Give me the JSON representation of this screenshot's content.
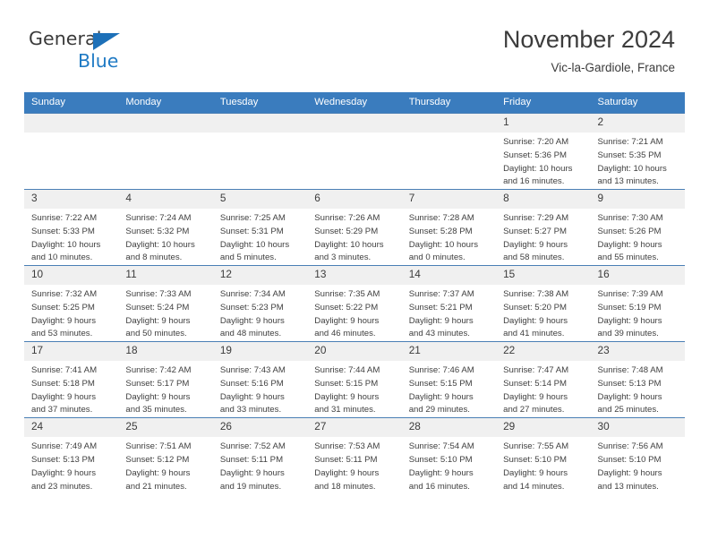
{
  "logo": {
    "word_one": "General",
    "word_two": "Blue",
    "triangle_icon": "triangle-icon",
    "brand_blue": "#1f7ac4"
  },
  "header": {
    "title": "November 2024",
    "subtitle": "Vic-la-Gardiole, France"
  },
  "calendar": {
    "header_bg": "#3a7cbe",
    "daynum_bg": "#f0f0f0",
    "weekday_names": [
      "Sunday",
      "Monday",
      "Tuesday",
      "Wednesday",
      "Thursday",
      "Friday",
      "Saturday"
    ],
    "labels": {
      "sunrise": "Sunrise:",
      "sunset": "Sunset:",
      "daylight": "Daylight:"
    },
    "weeks": [
      [
        {
          "day": "",
          "empty": true,
          "sunrise": "",
          "sunset": "",
          "daylight_line1": "",
          "daylight_line2": ""
        },
        {
          "day": "",
          "empty": true,
          "sunrise": "",
          "sunset": "",
          "daylight_line1": "",
          "daylight_line2": ""
        },
        {
          "day": "",
          "empty": true,
          "sunrise": "",
          "sunset": "",
          "daylight_line1": "",
          "daylight_line2": ""
        },
        {
          "day": "",
          "empty": true,
          "sunrise": "",
          "sunset": "",
          "daylight_line1": "",
          "daylight_line2": ""
        },
        {
          "day": "",
          "empty": true,
          "sunrise": "",
          "sunset": "",
          "daylight_line1": "",
          "daylight_line2": ""
        },
        {
          "day": "1",
          "empty": false,
          "sunrise": "Sunrise: 7:20 AM",
          "sunset": "Sunset: 5:36 PM",
          "daylight_line1": "Daylight: 10 hours",
          "daylight_line2": "and 16 minutes."
        },
        {
          "day": "2",
          "empty": false,
          "sunrise": "Sunrise: 7:21 AM",
          "sunset": "Sunset: 5:35 PM",
          "daylight_line1": "Daylight: 10 hours",
          "daylight_line2": "and 13 minutes."
        }
      ],
      [
        {
          "day": "3",
          "empty": false,
          "sunrise": "Sunrise: 7:22 AM",
          "sunset": "Sunset: 5:33 PM",
          "daylight_line1": "Daylight: 10 hours",
          "daylight_line2": "and 10 minutes."
        },
        {
          "day": "4",
          "empty": false,
          "sunrise": "Sunrise: 7:24 AM",
          "sunset": "Sunset: 5:32 PM",
          "daylight_line1": "Daylight: 10 hours",
          "daylight_line2": "and 8 minutes."
        },
        {
          "day": "5",
          "empty": false,
          "sunrise": "Sunrise: 7:25 AM",
          "sunset": "Sunset: 5:31 PM",
          "daylight_line1": "Daylight: 10 hours",
          "daylight_line2": "and 5 minutes."
        },
        {
          "day": "6",
          "empty": false,
          "sunrise": "Sunrise: 7:26 AM",
          "sunset": "Sunset: 5:29 PM",
          "daylight_line1": "Daylight: 10 hours",
          "daylight_line2": "and 3 minutes."
        },
        {
          "day": "7",
          "empty": false,
          "sunrise": "Sunrise: 7:28 AM",
          "sunset": "Sunset: 5:28 PM",
          "daylight_line1": "Daylight: 10 hours",
          "daylight_line2": "and 0 minutes."
        },
        {
          "day": "8",
          "empty": false,
          "sunrise": "Sunrise: 7:29 AM",
          "sunset": "Sunset: 5:27 PM",
          "daylight_line1": "Daylight: 9 hours",
          "daylight_line2": "and 58 minutes."
        },
        {
          "day": "9",
          "empty": false,
          "sunrise": "Sunrise: 7:30 AM",
          "sunset": "Sunset: 5:26 PM",
          "daylight_line1": "Daylight: 9 hours",
          "daylight_line2": "and 55 minutes."
        }
      ],
      [
        {
          "day": "10",
          "empty": false,
          "sunrise": "Sunrise: 7:32 AM",
          "sunset": "Sunset: 5:25 PM",
          "daylight_line1": "Daylight: 9 hours",
          "daylight_line2": "and 53 minutes."
        },
        {
          "day": "11",
          "empty": false,
          "sunrise": "Sunrise: 7:33 AM",
          "sunset": "Sunset: 5:24 PM",
          "daylight_line1": "Daylight: 9 hours",
          "daylight_line2": "and 50 minutes."
        },
        {
          "day": "12",
          "empty": false,
          "sunrise": "Sunrise: 7:34 AM",
          "sunset": "Sunset: 5:23 PM",
          "daylight_line1": "Daylight: 9 hours",
          "daylight_line2": "and 48 minutes."
        },
        {
          "day": "13",
          "empty": false,
          "sunrise": "Sunrise: 7:35 AM",
          "sunset": "Sunset: 5:22 PM",
          "daylight_line1": "Daylight: 9 hours",
          "daylight_line2": "and 46 minutes."
        },
        {
          "day": "14",
          "empty": false,
          "sunrise": "Sunrise: 7:37 AM",
          "sunset": "Sunset: 5:21 PM",
          "daylight_line1": "Daylight: 9 hours",
          "daylight_line2": "and 43 minutes."
        },
        {
          "day": "15",
          "empty": false,
          "sunrise": "Sunrise: 7:38 AM",
          "sunset": "Sunset: 5:20 PM",
          "daylight_line1": "Daylight: 9 hours",
          "daylight_line2": "and 41 minutes."
        },
        {
          "day": "16",
          "empty": false,
          "sunrise": "Sunrise: 7:39 AM",
          "sunset": "Sunset: 5:19 PM",
          "daylight_line1": "Daylight: 9 hours",
          "daylight_line2": "and 39 minutes."
        }
      ],
      [
        {
          "day": "17",
          "empty": false,
          "sunrise": "Sunrise: 7:41 AM",
          "sunset": "Sunset: 5:18 PM",
          "daylight_line1": "Daylight: 9 hours",
          "daylight_line2": "and 37 minutes."
        },
        {
          "day": "18",
          "empty": false,
          "sunrise": "Sunrise: 7:42 AM",
          "sunset": "Sunset: 5:17 PM",
          "daylight_line1": "Daylight: 9 hours",
          "daylight_line2": "and 35 minutes."
        },
        {
          "day": "19",
          "empty": false,
          "sunrise": "Sunrise: 7:43 AM",
          "sunset": "Sunset: 5:16 PM",
          "daylight_line1": "Daylight: 9 hours",
          "daylight_line2": "and 33 minutes."
        },
        {
          "day": "20",
          "empty": false,
          "sunrise": "Sunrise: 7:44 AM",
          "sunset": "Sunset: 5:15 PM",
          "daylight_line1": "Daylight: 9 hours",
          "daylight_line2": "and 31 minutes."
        },
        {
          "day": "21",
          "empty": false,
          "sunrise": "Sunrise: 7:46 AM",
          "sunset": "Sunset: 5:15 PM",
          "daylight_line1": "Daylight: 9 hours",
          "daylight_line2": "and 29 minutes."
        },
        {
          "day": "22",
          "empty": false,
          "sunrise": "Sunrise: 7:47 AM",
          "sunset": "Sunset: 5:14 PM",
          "daylight_line1": "Daylight: 9 hours",
          "daylight_line2": "and 27 minutes."
        },
        {
          "day": "23",
          "empty": false,
          "sunrise": "Sunrise: 7:48 AM",
          "sunset": "Sunset: 5:13 PM",
          "daylight_line1": "Daylight: 9 hours",
          "daylight_line2": "and 25 minutes."
        }
      ],
      [
        {
          "day": "24",
          "empty": false,
          "sunrise": "Sunrise: 7:49 AM",
          "sunset": "Sunset: 5:13 PM",
          "daylight_line1": "Daylight: 9 hours",
          "daylight_line2": "and 23 minutes."
        },
        {
          "day": "25",
          "empty": false,
          "sunrise": "Sunrise: 7:51 AM",
          "sunset": "Sunset: 5:12 PM",
          "daylight_line1": "Daylight: 9 hours",
          "daylight_line2": "and 21 minutes."
        },
        {
          "day": "26",
          "empty": false,
          "sunrise": "Sunrise: 7:52 AM",
          "sunset": "Sunset: 5:11 PM",
          "daylight_line1": "Daylight: 9 hours",
          "daylight_line2": "and 19 minutes."
        },
        {
          "day": "27",
          "empty": false,
          "sunrise": "Sunrise: 7:53 AM",
          "sunset": "Sunset: 5:11 PM",
          "daylight_line1": "Daylight: 9 hours",
          "daylight_line2": "and 18 minutes."
        },
        {
          "day": "28",
          "empty": false,
          "sunrise": "Sunrise: 7:54 AM",
          "sunset": "Sunset: 5:10 PM",
          "daylight_line1": "Daylight: 9 hours",
          "daylight_line2": "and 16 minutes."
        },
        {
          "day": "29",
          "empty": false,
          "sunrise": "Sunrise: 7:55 AM",
          "sunset": "Sunset: 5:10 PM",
          "daylight_line1": "Daylight: 9 hours",
          "daylight_line2": "and 14 minutes."
        },
        {
          "day": "30",
          "empty": false,
          "sunrise": "Sunrise: 7:56 AM",
          "sunset": "Sunset: 5:10 PM",
          "daylight_line1": "Daylight: 9 hours",
          "daylight_line2": "and 13 minutes."
        }
      ]
    ]
  }
}
